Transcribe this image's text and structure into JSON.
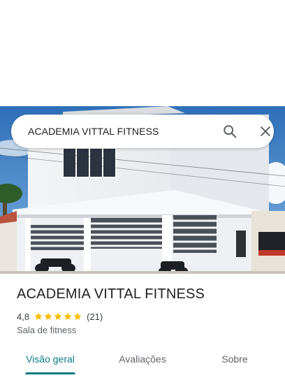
{
  "search": {
    "query": "ACADEMIA VITTAL FITNESS",
    "search_icon": "search-icon",
    "close_icon": "close-icon"
  },
  "photo": {
    "subject": "building-photo"
  },
  "place": {
    "title": "ACADEMIA VITTAL FITNESS",
    "rating": "4,8",
    "stars": 5,
    "review_count": "(21)",
    "category": "Sala de fitness"
  },
  "tabs": [
    {
      "label": "Visão geral",
      "active": true
    },
    {
      "label": "Avaliações",
      "active": false
    },
    {
      "label": "Sobre",
      "active": false
    }
  ],
  "colors": {
    "accent": "#0b7b83",
    "star": "#fbbc04",
    "text": "#202124",
    "secondary_text": "#5f6368"
  }
}
